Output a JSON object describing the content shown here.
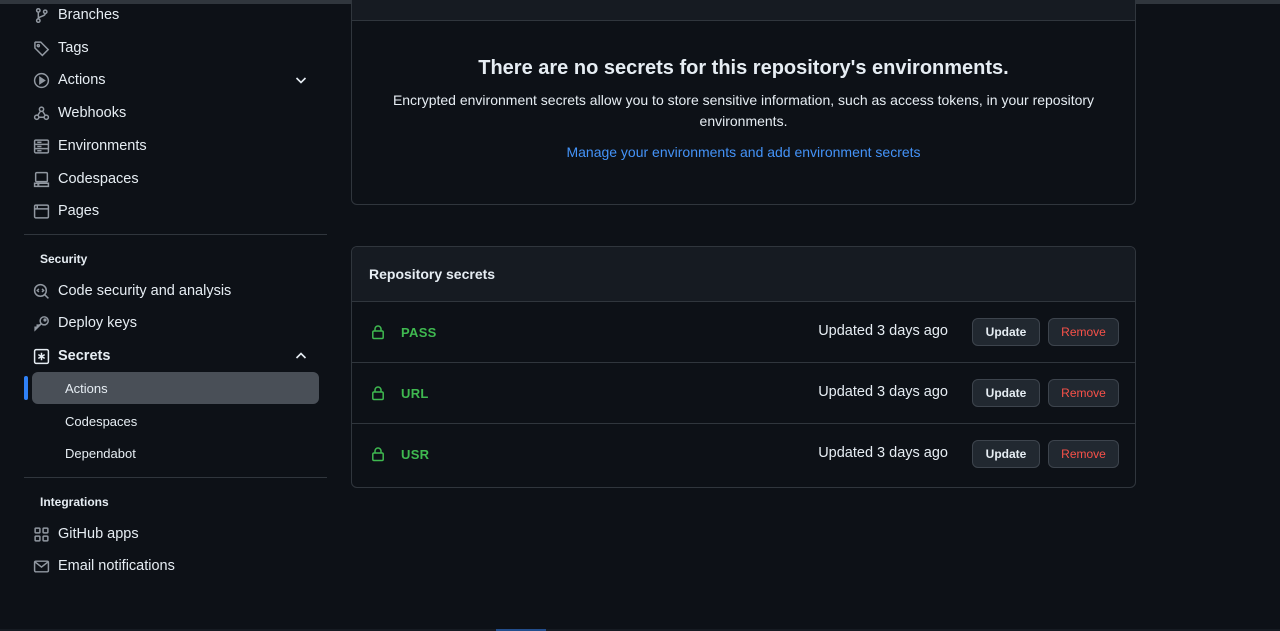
{
  "sidebar": {
    "items": [
      {
        "label": "Branches",
        "icon": "git-branch-icon"
      },
      {
        "label": "Tags",
        "icon": "tag-icon"
      },
      {
        "label": "Actions",
        "icon": "play-icon"
      },
      {
        "label": "Webhooks",
        "icon": "webhook-icon"
      },
      {
        "label": "Environments",
        "icon": "server-icon"
      },
      {
        "label": "Codespaces",
        "icon": "codespaces-icon"
      },
      {
        "label": "Pages",
        "icon": "browser-icon"
      }
    ],
    "security_heading": "Security",
    "security_items": [
      {
        "label": "Code security and analysis",
        "icon": "codescan-icon"
      },
      {
        "label": "Deploy keys",
        "icon": "key-icon"
      },
      {
        "label": "Secrets",
        "icon": "asterisk-icon"
      }
    ],
    "secrets_subitems": [
      {
        "label": "Actions"
      },
      {
        "label": "Codespaces"
      },
      {
        "label": "Dependabot"
      }
    ],
    "integrations_heading": "Integrations",
    "integration_items": [
      {
        "label": "GitHub apps",
        "icon": "apps-icon"
      },
      {
        "label": "Email notifications",
        "icon": "mail-icon"
      }
    ]
  },
  "environments": {
    "title": "There are no secrets for this repository's environments.",
    "description": "Encrypted environment secrets allow you to store sensitive information, such as access tokens, in your repository environments.",
    "link": "Manage your environments and add environment secrets"
  },
  "repository_secrets": {
    "title": "Repository secrets",
    "rows": [
      {
        "name": "PASS",
        "updated": "Updated 3 days ago",
        "update_label": "Update",
        "remove_label": "Remove"
      },
      {
        "name": "URL",
        "updated": "Updated 3 days ago",
        "update_label": "Update",
        "remove_label": "Remove"
      },
      {
        "name": "USR",
        "updated": "Updated 3 days ago",
        "update_label": "Update",
        "remove_label": "Remove"
      }
    ]
  },
  "colors": {
    "background": "#0d1117",
    "accent": "#2f81f7",
    "link": "#4493f8",
    "success": "#3fb950",
    "danger": "#f85149"
  }
}
